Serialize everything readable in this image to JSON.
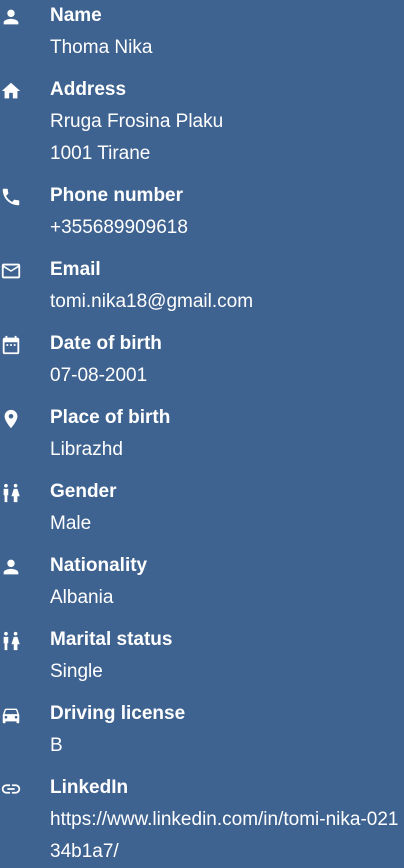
{
  "fields": [
    {
      "label": "Name",
      "value": "Thoma Nika",
      "icon": "person-icon"
    },
    {
      "label": "Address",
      "value": "Rruga Frosina Plaku\n1001 Tirane",
      "icon": "home-icon"
    },
    {
      "label": "Phone number",
      "value": "+355689909618",
      "icon": "phone-icon"
    },
    {
      "label": "Email",
      "value": "tomi.nika18@gmail.com",
      "icon": "email-icon"
    },
    {
      "label": "Date of birth",
      "value": "07-08-2001",
      "icon": "calendar-icon"
    },
    {
      "label": "Place of birth",
      "value": "Librazhd",
      "icon": "location-pin-icon"
    },
    {
      "label": "Gender",
      "value": "Male",
      "icon": "gender-icon"
    },
    {
      "label": "Nationality",
      "value": "Albania",
      "icon": "person-icon"
    },
    {
      "label": "Marital status",
      "value": "Single",
      "icon": "people-icon"
    },
    {
      "label": "Driving license",
      "value": "B",
      "icon": "car-icon"
    },
    {
      "label": "LinkedIn",
      "value": "https://www.linkedin.com/in/tomi-nika-02134b1a7/",
      "icon": "link-icon"
    }
  ]
}
